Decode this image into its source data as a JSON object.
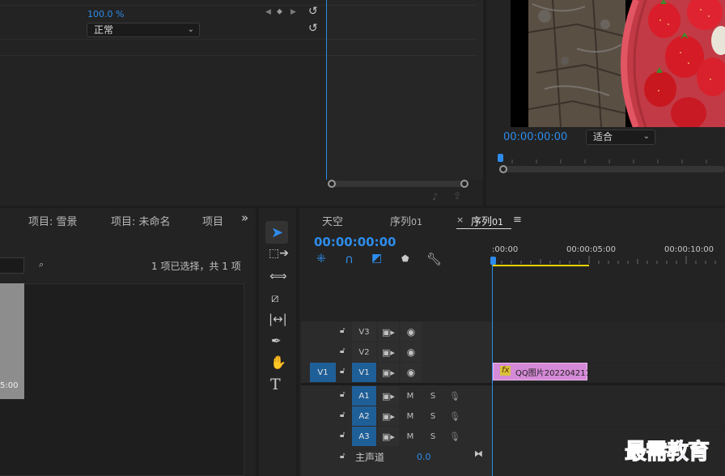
{
  "effect_controls": {
    "opacity_value": "100.0 %",
    "blend_mode": "正常"
  },
  "program_monitor": {
    "timecode": "00:00:00:00",
    "fit": "适合"
  },
  "project_panel": {
    "tabs": [
      "项目: 雪景",
      "项目: 未命名",
      "项目"
    ],
    "selection_status": "1 项已选择，共 1 项",
    "thumb_time": "5:00"
  },
  "timeline": {
    "tabs": [
      "天空",
      "序列",
      "序列"
    ],
    "tab_suffix": "01",
    "timecode": "00:00:00:00",
    "ruler": [
      ":00:00",
      "00:00:05:00",
      "00:00:10:00"
    ],
    "tracks": {
      "v3": "V3",
      "v2": "V2",
      "v1": "V1",
      "v1_source": "V1",
      "a1": "A1",
      "a2": "A2",
      "a3": "A3",
      "m": "M",
      "s": "S",
      "master": "主声道",
      "master_value": "0.0"
    },
    "clip": {
      "fx": "fx",
      "name": "QQ图片202204211"
    }
  },
  "watermark": "最需教育",
  "colors": {
    "accent": "#2d8ceb",
    "clip": "#d58ad7",
    "track_target": "#1f5f98"
  }
}
